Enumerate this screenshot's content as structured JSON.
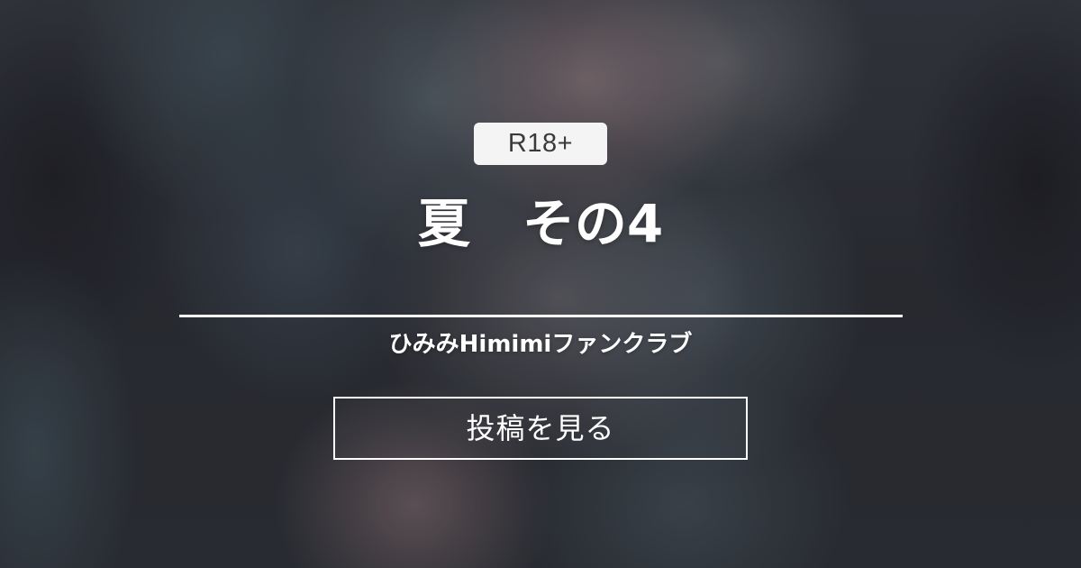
{
  "badge": {
    "label": "R18+"
  },
  "post": {
    "title": "夏　その4"
  },
  "fanclub": {
    "name": "ひみみHimimiファンクラブ"
  },
  "actions": {
    "view_post_label": "投稿を見る"
  },
  "colors": {
    "text": "#ffffff",
    "badge_background": "#f4f4f4",
    "badge_text": "#3a3a3a"
  }
}
